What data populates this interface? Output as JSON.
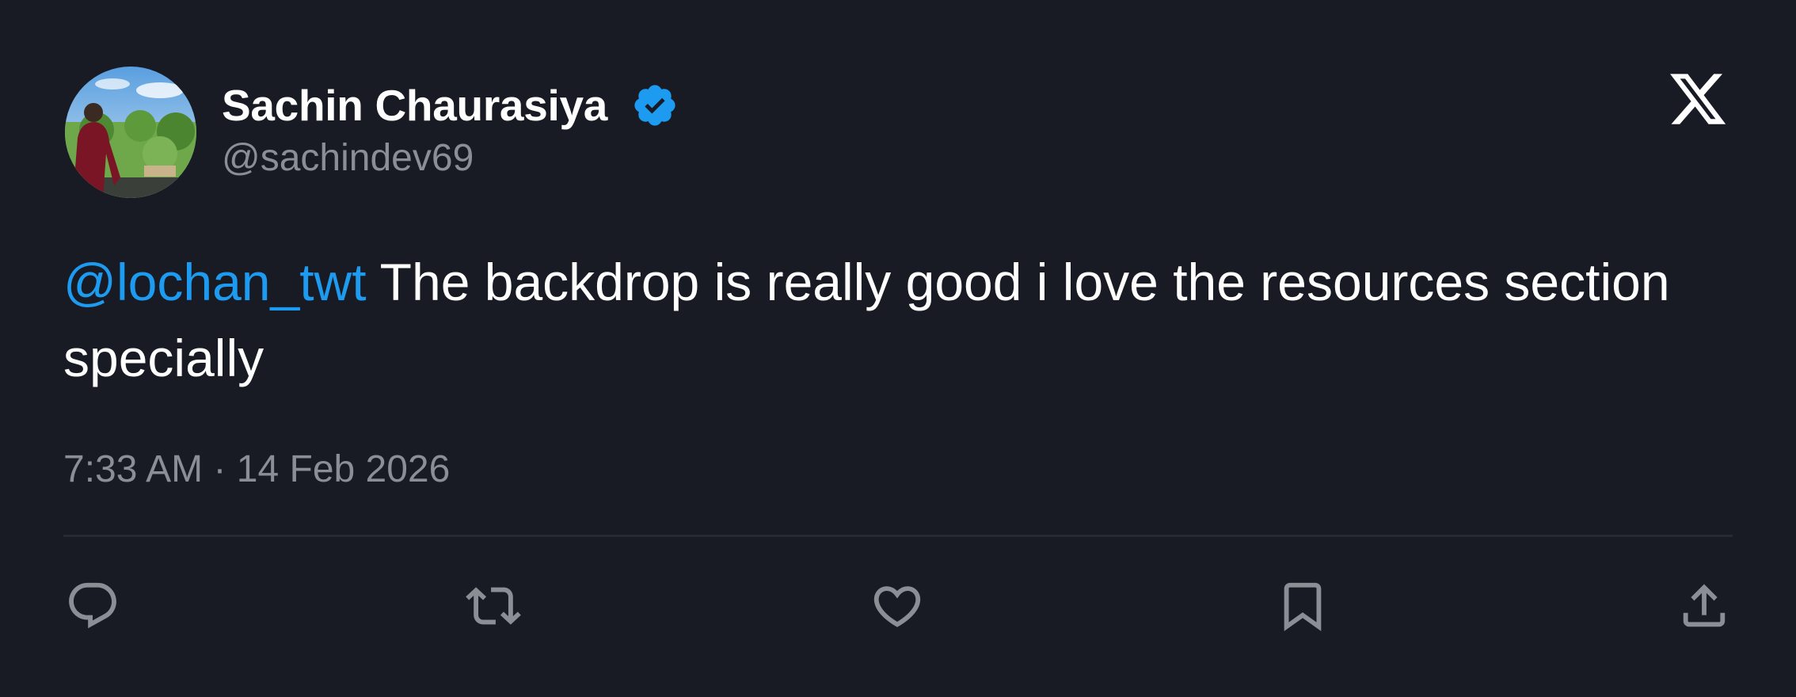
{
  "user": {
    "display_name": "Sachin Chaurasiya",
    "handle": "@sachindev69",
    "verified": true
  },
  "tweet": {
    "mention": "@lochan_twt",
    "text": " The backdrop is really good i love the resources section specially",
    "timestamp": "7:33 AM · 14 Feb 2026"
  },
  "icons": {
    "brand": "x-logo-icon",
    "verified": "verified-badge-icon",
    "reply": "reply-icon",
    "retweet": "retweet-icon",
    "like": "heart-icon",
    "bookmark": "bookmark-icon",
    "share": "share-icon"
  },
  "colors": {
    "background": "#181b24",
    "text": "#ffffff",
    "muted": "#8b8e95",
    "accent": "#1d9bf0",
    "divider": "#262a33"
  }
}
